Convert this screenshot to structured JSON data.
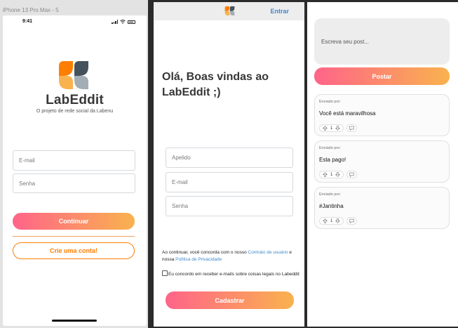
{
  "frame1": {
    "caption": "iPhone 13 Pro Max - 5",
    "status_time": "9:41",
    "brand": {
      "title": "LabEddit",
      "subtitle": "O projeto de rede social da Labenu"
    },
    "login": {
      "email_placeholder": "E-mail",
      "password_placeholder": "Senha",
      "continue_label": "Continuar",
      "create_account_label": "Crie uma conta!"
    }
  },
  "frame2": {
    "header": {
      "login_link": "Entrar"
    },
    "welcome": "Olá, Boas vindas ao LabEddit ;)",
    "form": {
      "nickname_placeholder": "Apelido",
      "email_placeholder": "E-mail",
      "password_placeholder": "Senha"
    },
    "terms": {
      "prefix": "Ao continuar, você concorda com o nosso ",
      "contract_link": "Contrato de usuário",
      "middle": " e nossa ",
      "privacy_link": "Política de Privacidade"
    },
    "consent_label": "Eu concordo em receber e-mails sobre coisas legais no Labeddit",
    "signup_label": "Cadastrar"
  },
  "frame3": {
    "post_placeholder": "Escreva seu post...",
    "post_button": "Postar",
    "posts": [
      {
        "by": "Enviado por:",
        "text": "Você está maravilhosa",
        "votes": "1"
      },
      {
        "by": "Enviado por:",
        "text": "Esta pago!",
        "votes": "1"
      },
      {
        "by": "Enviado por:",
        "text": "#Jantinha",
        "votes": "1"
      }
    ]
  },
  "colors": {
    "gradient_start": "#ff6489",
    "gradient_end": "#f9b24e",
    "accent_orange": "#fe7e02",
    "link_blue": "#4088cb",
    "logo_orange": "#fe7e02",
    "logo_yellow": "#f9b24e",
    "logo_slate": "#45525b"
  },
  "icons": [
    "labeddit-logo",
    "upvote-arrow-icon",
    "downvote-arrow-icon",
    "comment-icon",
    "signal-icon",
    "wifi-icon",
    "battery-icon"
  ]
}
